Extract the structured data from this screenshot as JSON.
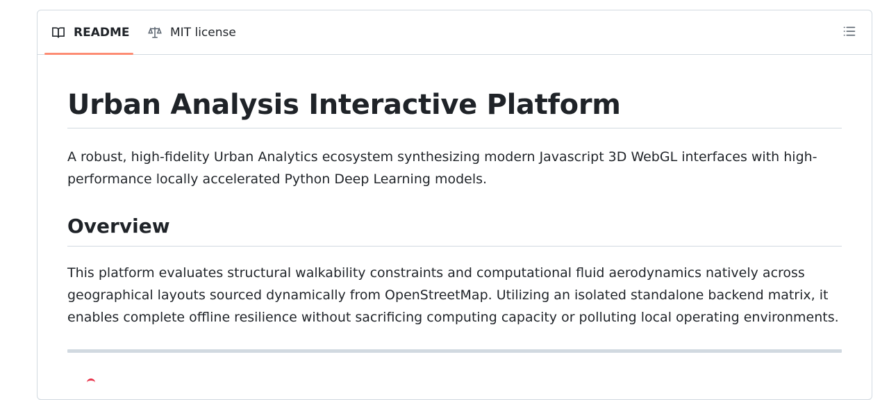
{
  "tabs": [
    {
      "label": "README",
      "icon": "book-icon"
    },
    {
      "label": "MIT license",
      "icon": "scale-icon"
    }
  ],
  "toc_icon": "list-icon",
  "readme": {
    "title": "Urban Analysis Interactive Platform",
    "description": "A robust, high-fidelity Urban Analytics ecosystem synthesizing modern Javascript 3D WebGL interfaces with high-performance locally accelerated Python Deep Learning models.",
    "overview_heading": "Overview",
    "overview_text": "This platform evaluates structural walkability constraints and computational fluid aerodynamics natively across geographical layouts sourced dynamically from OpenStreetMap. Utilizing an isolated standalone backend matrix, it enables complete offline resilience without sacrificing computing capacity or polluting local operating environments."
  },
  "colors": {
    "accent_underline": "#fd8c73",
    "border": "#d1d9e0",
    "text": "#1f2328"
  }
}
